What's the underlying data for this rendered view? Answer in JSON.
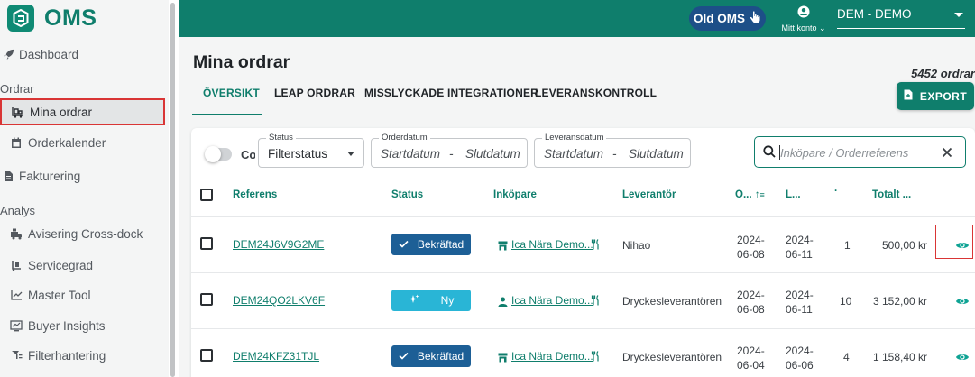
{
  "app": {
    "logo_text": "OMS"
  },
  "sidebar": {
    "dashboard": "Dashboard",
    "section_orders": "Ordrar",
    "my_orders": "Mina ordrar",
    "order_calendar": "Orderkalender",
    "invoicing": "Fakturering",
    "section_analysis": "Analys",
    "crossdock": "Avisering Cross-dock",
    "service_level": "Servicegrad",
    "master_tool": "Master Tool",
    "buyer_insights": "Buyer Insights",
    "filter_handling": "Filterhantering"
  },
  "topbar": {
    "old_oms": "Old OMS",
    "account": "Mitt konto",
    "tenant": "DEM - DEMO"
  },
  "main": {
    "title": "Mina ordrar",
    "order_count": "5452 ordrar",
    "export": "EXPORT",
    "tabs": [
      "ÖVERSIKT",
      "LEAP ORDRAR",
      "MISSLYCKADE INTEGRATIONER",
      "LEVERANSKONTROLL"
    ]
  },
  "filters": {
    "toggle_label": "Co",
    "status_legend": "Status",
    "status_value": "Filterstatus",
    "orderdate_legend": "Orderdatum",
    "leverans_legend": "Leveransdatum",
    "start": "Startdatum",
    "dash": "-",
    "end": "Slutdatum",
    "search_placeholder": "Inköpare / Orderreferens"
  },
  "table": {
    "headers": {
      "ref": "Referens",
      "status": "Status",
      "buyer": "Inköpare",
      "supplier": "Leverantör",
      "order_date": "O...",
      "delivery": "L...",
      "qty": "·",
      "total": "Totalt ..."
    },
    "rows": [
      {
        "ref": "DEM24J6V9G2ME",
        "status": "Bekräftad",
        "buyer": "Ica Nära Demo...",
        "supplier": "Nihao",
        "order_year": "2024-",
        "order_day": "06-08",
        "del_year": "2024-",
        "del_day": "06-11",
        "qty": "1",
        "total": "500,00 kr"
      },
      {
        "ref": "DEM24QO2LKV6F",
        "status": "Ny",
        "buyer": "Ica Nära Demo...",
        "supplier": "Dryckesleverantören",
        "order_year": "2024-",
        "order_day": "06-08",
        "del_year": "2024-",
        "del_day": "06-11",
        "qty": "10",
        "total": "3 152,00 kr"
      },
      {
        "ref": "DEM24KFZ31TJL",
        "status": "Bekräftad",
        "buyer": "Ica Nära Demo...",
        "supplier": "Dryckesleverantören",
        "order_year": "2024-",
        "order_day": "06-04",
        "del_year": "2024-",
        "del_day": "06-06",
        "qty": "4",
        "total": "1 158,40 kr"
      }
    ]
  },
  "colors": {
    "brand": "#0f7e6c",
    "confirmed": "#1d5f96",
    "new": "#29b5d6",
    "highlight": "#d93535"
  }
}
